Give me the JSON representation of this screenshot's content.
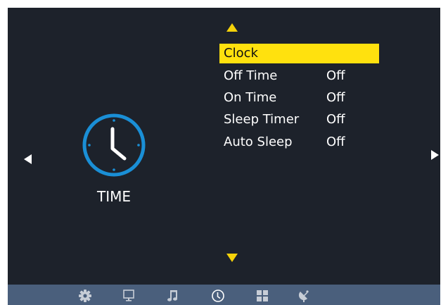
{
  "colors": {
    "background": "#1d222b",
    "highlight": "#ffe10e",
    "arrow_accent": "#f5d20a",
    "bottom_bar": "#4a5f7c",
    "clock_accent": "#1a8fd6"
  },
  "section": {
    "icon": "clock-icon",
    "label": "TIME"
  },
  "menu": {
    "selected_index": 0,
    "items": [
      {
        "label": "Clock",
        "value": ""
      },
      {
        "label": "Off Time",
        "value": "Off"
      },
      {
        "label": "On Time",
        "value": "Off"
      },
      {
        "label": "Sleep Timer",
        "value": "Off"
      },
      {
        "label": "Auto Sleep",
        "value": "Off"
      }
    ]
  },
  "bottom_nav": {
    "active_index": 3,
    "items": [
      {
        "icon": "gear-icon"
      },
      {
        "icon": "monitor-icon"
      },
      {
        "icon": "music-note-icon"
      },
      {
        "icon": "clock-icon"
      },
      {
        "icon": "grid-icon"
      },
      {
        "icon": "satellite-dish-icon"
      }
    ]
  }
}
